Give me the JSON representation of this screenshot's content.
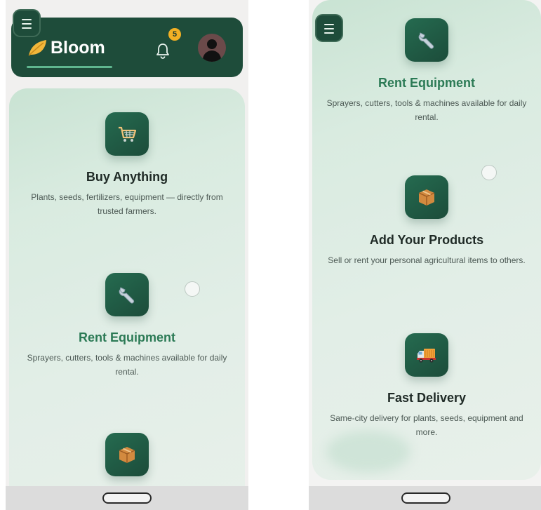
{
  "left_screen": {
    "header": {
      "brand_name": "Bloom",
      "leaf_icon": "leaf-icon",
      "notification_count": "5",
      "bell_icon": "bell-icon",
      "avatar_icon": "user-avatar-icon"
    },
    "menu_icon": "hamburger-menu-icon",
    "features": [
      {
        "icon": "shopping-cart-icon",
        "title": "Buy Anything",
        "description": "Plants, seeds, fertilizers, equipment — directly from trusted farmers."
      },
      {
        "icon": "wrench-icon",
        "title": "Rent Equipment",
        "description": "Sprayers, cutters, tools & machines available for daily rental."
      },
      {
        "icon": "package-icon",
        "title": "",
        "description": ""
      }
    ]
  },
  "right_screen": {
    "menu_icon": "hamburger-menu-icon",
    "features": [
      {
        "icon": "wrench-icon",
        "title": "Rent Equipment",
        "description": "Sprayers, cutters, tools & machines available for daily rental."
      },
      {
        "icon": "package-icon",
        "title": "Add Your Products",
        "description": "Sell or rent your personal agricultural items to others."
      },
      {
        "icon": "delivery-truck-icon",
        "title": "Fast Delivery",
        "description": "Same-city delivery for plants, seeds, equipment and more."
      }
    ]
  },
  "colors": {
    "header_bg": "#1e4c3a",
    "accent_green": "#2b7a55",
    "badge": "#f2b024",
    "panel_mint": "#d9ebe0"
  }
}
